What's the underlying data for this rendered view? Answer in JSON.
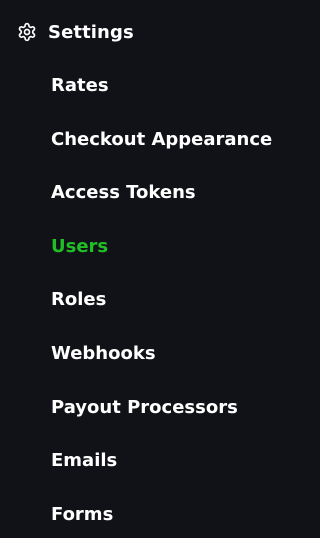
{
  "settings": {
    "label": "Settings",
    "icon": "gear-icon"
  },
  "menu": {
    "active_color": "#1fbf25",
    "items": [
      {
        "label": "Rates",
        "active": false
      },
      {
        "label": "Checkout Appearance",
        "active": false
      },
      {
        "label": "Access Tokens",
        "active": false
      },
      {
        "label": "Users",
        "active": true
      },
      {
        "label": "Roles",
        "active": false
      },
      {
        "label": "Webhooks",
        "active": false
      },
      {
        "label": "Payout Processors",
        "active": false
      },
      {
        "label": "Emails",
        "active": false
      },
      {
        "label": "Forms",
        "active": false
      }
    ]
  }
}
